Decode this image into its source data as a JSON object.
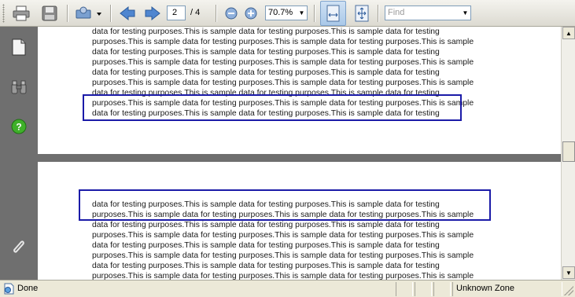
{
  "toolbar": {
    "page_current": "2",
    "page_total": "/ 4",
    "zoom_value": "70.7%",
    "find_placeholder": "Find",
    "icons": [
      "print-icon",
      "save-icon",
      "tools-dropdown-icon",
      "prev-page-icon",
      "next-page-icon",
      "zoom-out-icon",
      "zoom-in-icon",
      "fit-width-icon",
      "fit-page-icon"
    ]
  },
  "nav": {
    "icons": [
      "pages-icon",
      "binoculars-icon",
      "help-icon",
      "attachment-icon"
    ]
  },
  "document": {
    "page1_lines": [
      "data for testing purposes.This is sample data for testing purposes.This is sample data for testing",
      "purposes.This is sample data for testing purposes.This is sample data for testing purposes.This is sample",
      "data for testing purposes.This is sample data for testing purposes.This is sample data for testing",
      "purposes.This is sample data for testing purposes.This is sample data for testing purposes.This is sample",
      "data for testing purposes.This is sample data for testing purposes.This is sample data for testing",
      "purposes.This is sample data for testing purposes.This is sample data for testing purposes.This is sample",
      "data for testing purposes.This is sample data for testing purposes.This is sample data for testing",
      "purposes.This is sample data for testing purposes.This is sample data for testing purposes.This is sample",
      "data for testing purposes.This is sample data for testing purposes.This is sample data for testing"
    ],
    "page2_lines": [
      "data for testing purposes.This is sample data for testing purposes.This is sample data for testing",
      "purposes.This is sample data for testing purposes.This is sample data for testing purposes.This is sample",
      "data for testing purposes.This is sample data for testing purposes.This is sample data for testing",
      "purposes.This is sample data for testing purposes.This is sample data for testing purposes.This is sample",
      "data for testing purposes.This is sample data for testing purposes.This is sample data for testing",
      "purposes.This is sample data for testing purposes.This is sample data for testing purposes.This is sample",
      "data for testing purposes.This is sample data for testing purposes.This is sample data for testing",
      "purposes.This is sample data for testing purposes.This is sample data for testing purposes.This is sample"
    ],
    "highlight_color": "#1b1ba8"
  },
  "status": {
    "text": "Done",
    "zone": "Unknown Zone"
  }
}
